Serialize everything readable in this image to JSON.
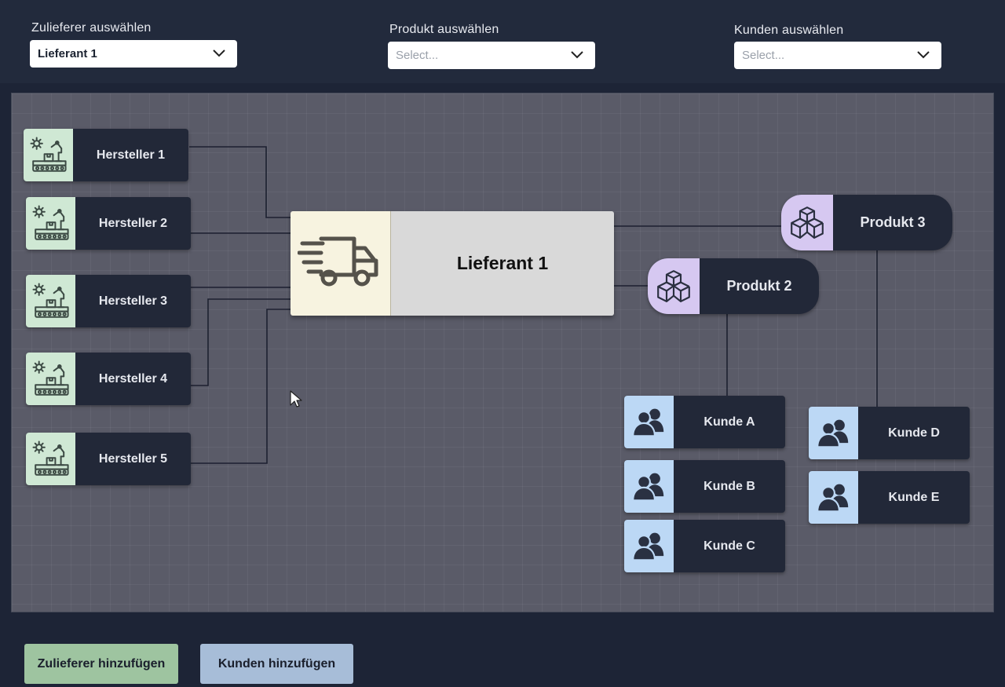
{
  "filters": {
    "supplier": {
      "label": "Zulieferer auswählen",
      "value": "Lieferant 1"
    },
    "product": {
      "label": "Produkt auswählen",
      "placeholder": "Select..."
    },
    "customer": {
      "label": "Kunden auswählen",
      "placeholder": "Select..."
    }
  },
  "graph": {
    "manufacturers": [
      "Hersteller 1",
      "Hersteller 2",
      "Hersteller 3",
      "Hersteller 4",
      "Hersteller 5"
    ],
    "supplier": "Lieferant 1",
    "products": [
      "Produkt 3",
      "Produkt 2"
    ],
    "customers": [
      "Kunde A",
      "Kunde B",
      "Kunde C",
      "Kunde D",
      "Kunde E"
    ]
  },
  "actions": {
    "add_supplier": "Zulieferer hinzufügen",
    "add_customer": "Kunden hinzufügen"
  },
  "colors": {
    "manufacturer_icon_bg": "#cfe8d4",
    "product_icon_bg": "#d6c8f1",
    "customer_icon_bg": "#bcd8f5",
    "supplier_icon_bg": "#f7f3e0",
    "add_supplier_button": "#9ec4a0",
    "add_customer_button": "#a7bdd8"
  }
}
